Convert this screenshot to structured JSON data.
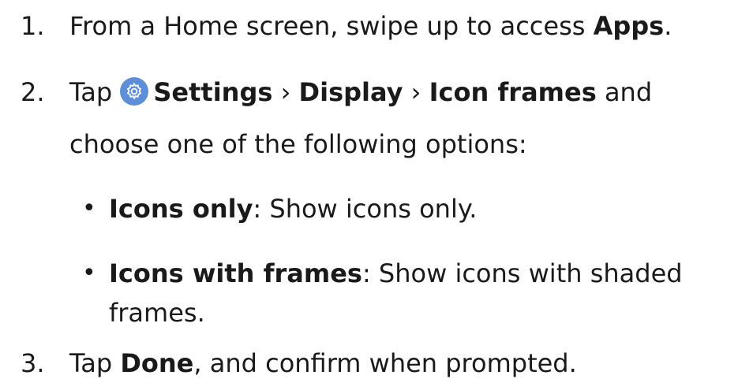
{
  "steps": [
    {
      "number": "1.",
      "lines": [
        {
          "pre": "From a Home screen, swipe up to access ",
          "bold": "Apps",
          "post": "."
        }
      ]
    },
    {
      "number": "2.",
      "parts": {
        "tap": "Tap",
        "settings": "Settings",
        "sep1": " › ",
        "display": "Display",
        "sep2": " › ",
        "icon_frames": "Icon frames",
        "post": " and",
        "line2": "choose one of the following options:"
      },
      "icon": "settings-gear-icon",
      "icon_color": "#5d8ed8",
      "options": [
        {
          "bullet": "•",
          "bold": "Icons only",
          "text": ": Show icons only."
        },
        {
          "bullet": "•",
          "bold": "Icons with frames",
          "text": ": Show icons with shaded",
          "text2": "frames."
        }
      ]
    },
    {
      "number": "3.",
      "pre": "Tap ",
      "bold": "Done",
      "post": ", and confirm when prompted."
    }
  ]
}
